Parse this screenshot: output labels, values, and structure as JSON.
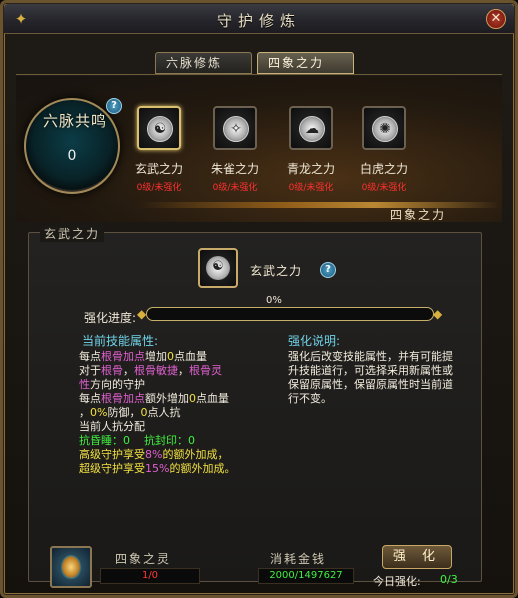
{
  "window": {
    "title": "守护修炼"
  },
  "tabs": [
    {
      "label": "六脉修炼"
    },
    {
      "label": "四象之力"
    }
  ],
  "resonance": {
    "label": "六脉共鸣",
    "value": "0"
  },
  "skills": [
    {
      "name": "玄武之力",
      "status": "0级/未强化",
      "icon": "black-tortoise-icon"
    },
    {
      "name": "朱雀之力",
      "status": "0级/未强化",
      "icon": "vermilion-bird-icon"
    },
    {
      "name": "青龙之力",
      "status": "0级/未强化",
      "icon": "azure-dragon-icon"
    },
    {
      "name": "白虎之力",
      "status": "0级/未强化",
      "icon": "white-tiger-icon"
    }
  ],
  "panel_corner_label": "四象之力",
  "detail": {
    "section_title": "玄武之力",
    "skill_name": "玄武之力",
    "progress_label": "强化进度:",
    "progress_percent": "0%",
    "progress_value": 0,
    "attr_title": "当前技能属性:",
    "desc_title": "强化说明:",
    "attr_lines": {
      "l1a": "每点",
      "l1b": "根骨加点",
      "l1c": "增加",
      "l1d": "0",
      "l1e": "点血量",
      "l2a": "对于",
      "l2b": "根骨",
      "l2c": "，",
      "l2d": "根骨敏捷",
      "l2e": "，",
      "l2f": "根骨灵",
      "l3a": "性",
      "l3b": "方向的守护",
      "l4a": "每点",
      "l4b": "根骨加点",
      "l4c": "额外增加",
      "l4d": "0",
      "l4e": "点血量",
      "l5a": "，",
      "l5b": "0%",
      "l5c": "防御，",
      "l5d": "0",
      "l5e": "点人抗",
      "l6": "当前人抗分配",
      "l7a": "抗昏睡：0",
      "l7b": "抗封印：0",
      "l8a": "高级守护享受",
      "l8b": "8%",
      "l8c": "的额外加成，",
      "l9a": "超级守护享受",
      "l9b": "15%",
      "l9c": "的额外加成。"
    },
    "desc_text": "强化后改变技能属性，并有可能提升技能道行，可选择采用新属性或保留原属性，保留原属性时当前道行不变。"
  },
  "bottom": {
    "spirit_label": "四象之灵",
    "spirit_value": "1/0",
    "cost_label": "消耗金钱",
    "cost_value": "2000/1497627",
    "strengthen_button": "强  化",
    "today_label": "今日强化:",
    "today_value": "0/3"
  }
}
